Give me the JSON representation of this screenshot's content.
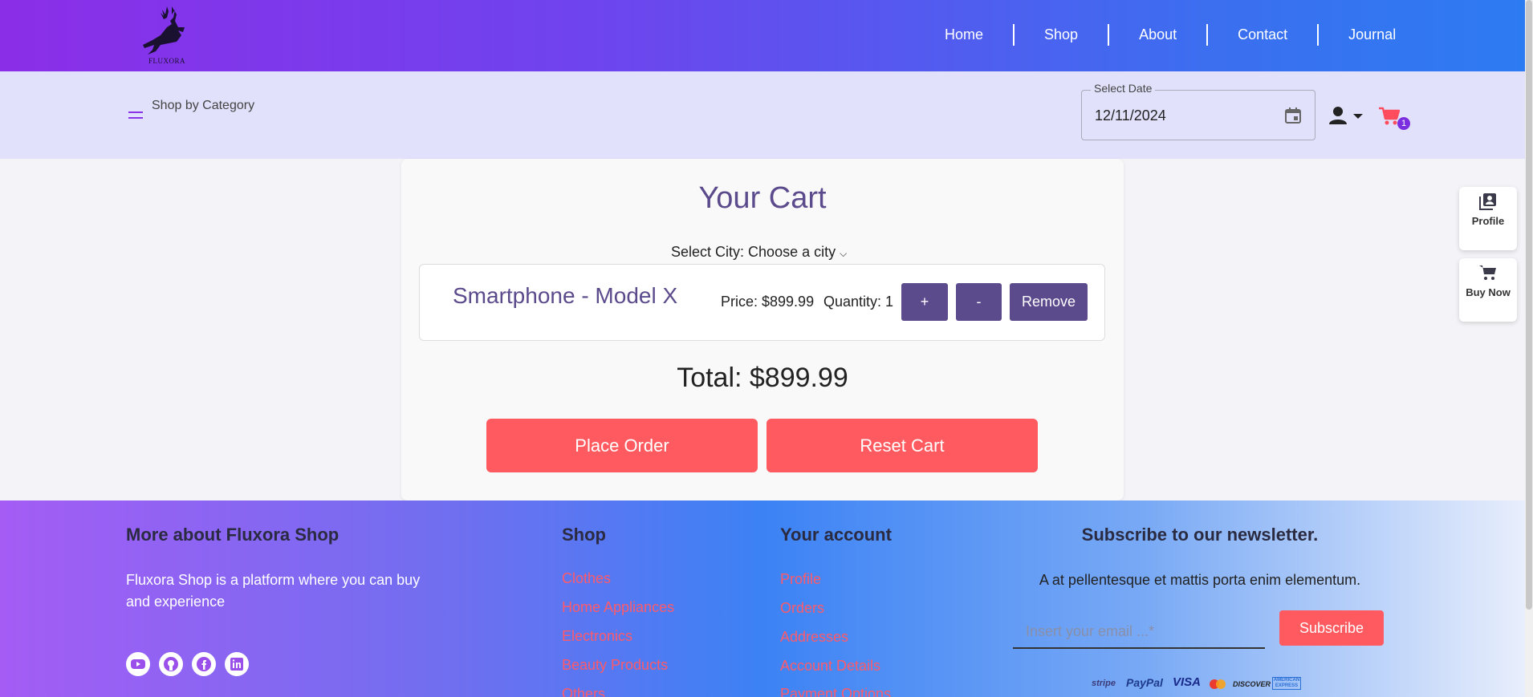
{
  "header": {
    "logo_text": "FLUXORA",
    "nav": [
      "Home",
      "Shop",
      "About",
      "Contact",
      "Journal"
    ]
  },
  "subbar": {
    "category_label": "Shop by Category",
    "date_label": "Select Date",
    "date_value": "12/11/2024",
    "cart_count": "1"
  },
  "side": {
    "profile_label": "Profile",
    "buy_label": "Buy Now"
  },
  "cart": {
    "title": "Your Cart",
    "city_label": "Select City:",
    "city_selected": "Choose a city",
    "item": {
      "name": "Smartphone - Model X",
      "price": "Price: $899.99",
      "quantity": "Quantity: 1",
      "plus_label": "+",
      "minus_label": "-",
      "remove_label": "Remove"
    },
    "total": "Total: $899.99",
    "place_order_label": "Place Order",
    "reset_label": "Reset Cart"
  },
  "footer": {
    "about_heading": "More about Fluxora Shop",
    "about_text": "Fluxora Shop is a platform where you can buy and experience",
    "shop_heading": "Shop",
    "shop_links": [
      "Clothes",
      "Home Appliances",
      "Electronics",
      "Beauty Products",
      "Others"
    ],
    "account_heading": "Your account",
    "account_links": [
      "Profile",
      "Orders",
      "Addresses",
      "Account Details",
      "Payment Options"
    ],
    "newsletter_heading": "Subscribe to our newsletter.",
    "newsletter_text": "A at pellentesque et mattis porta enim elementum.",
    "email_placeholder": "Insert your email ...*",
    "subscribe_label": "Subscribe",
    "payment_logos": [
      "stripe",
      "PayPal",
      "VISA",
      "mastercard",
      "DISCOVER",
      "AMERICAN EXPRESS"
    ]
  },
  "colors": {
    "accent": "#5b4a8c",
    "cta": "#ff5a5f",
    "link": "#ff5a6a",
    "subbar": "#e1e1fb"
  }
}
